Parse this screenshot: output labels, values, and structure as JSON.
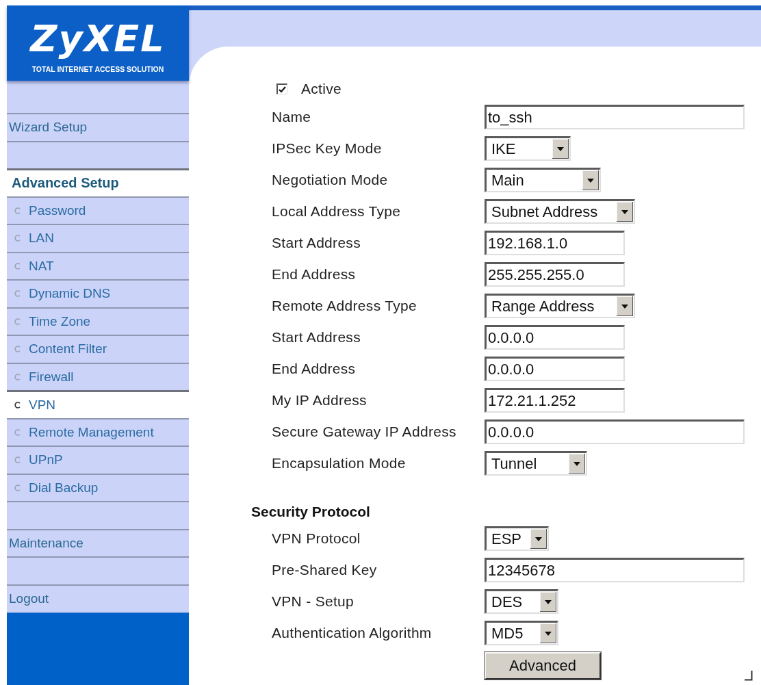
{
  "sidebar": {
    "logo": {
      "brand": "ZyXEL",
      "tagline": "TOTAL INTERNET ACCESS SOLUTION"
    },
    "items": [
      {
        "kind": "link",
        "label": "Wizard Setup"
      },
      {
        "kind": "heading",
        "label": "Advanced Setup"
      },
      {
        "kind": "option",
        "label": "Password",
        "selected": false
      },
      {
        "kind": "option",
        "label": "LAN",
        "selected": false
      },
      {
        "kind": "option",
        "label": "NAT",
        "selected": false
      },
      {
        "kind": "option",
        "label": "Dynamic DNS",
        "selected": false
      },
      {
        "kind": "option",
        "label": "Time Zone",
        "selected": false
      },
      {
        "kind": "option",
        "label": "Content Filter",
        "selected": false
      },
      {
        "kind": "option",
        "label": "Firewall",
        "selected": false
      },
      {
        "kind": "option",
        "label": "VPN",
        "selected": true
      },
      {
        "kind": "option",
        "label": "Remote Management",
        "selected": false
      },
      {
        "kind": "option",
        "label": "UPnP",
        "selected": false
      },
      {
        "kind": "option",
        "label": "Dial Backup",
        "selected": false
      },
      {
        "kind": "link",
        "label": "Maintenance"
      },
      {
        "kind": "link",
        "label": "Logout"
      }
    ]
  },
  "form": {
    "active": {
      "label": "Active",
      "checked": true
    },
    "sections": [
      {
        "fields": [
          {
            "kind": "text",
            "label": "Name",
            "value": "to_ssh"
          },
          {
            "kind": "select",
            "label": "IPSec Key Mode",
            "value": "IKE"
          },
          {
            "kind": "select",
            "label": "Negotiation Mode",
            "value": "Main"
          },
          {
            "kind": "select",
            "label": "Local Address Type",
            "value": "Subnet Address"
          },
          {
            "kind": "text",
            "label": "Start Address",
            "value": "192.168.1.0"
          },
          {
            "kind": "text",
            "label": "End Address",
            "value": "255.255.255.0"
          },
          {
            "kind": "select",
            "label": "Remote Address Type",
            "value": "Range Address"
          },
          {
            "kind": "text",
            "label": "Start Address",
            "value": "0.0.0.0"
          },
          {
            "kind": "text",
            "label": "End Address",
            "value": "0.0.0.0"
          },
          {
            "kind": "text",
            "label": "My IP Address",
            "value": "172.21.1.252"
          },
          {
            "kind": "text",
            "label": "Secure Gateway IP Address",
            "value": "0.0.0.0"
          },
          {
            "kind": "select",
            "label": "Encapsulation Mode",
            "value": "Tunnel"
          }
        ]
      },
      {
        "title": "Security Protocol",
        "fields": [
          {
            "kind": "select",
            "label": "VPN Protocol",
            "value": "ESP"
          },
          {
            "kind": "text",
            "label": "Pre-Shared Key",
            "value": "12345678"
          },
          {
            "kind": "select",
            "label": "VPN - Setup",
            "value": "DES"
          },
          {
            "kind": "select",
            "label": "Authentication Algorithm",
            "value": "MD5"
          }
        ]
      }
    ],
    "buttons": [
      "Advanced"
    ]
  }
}
